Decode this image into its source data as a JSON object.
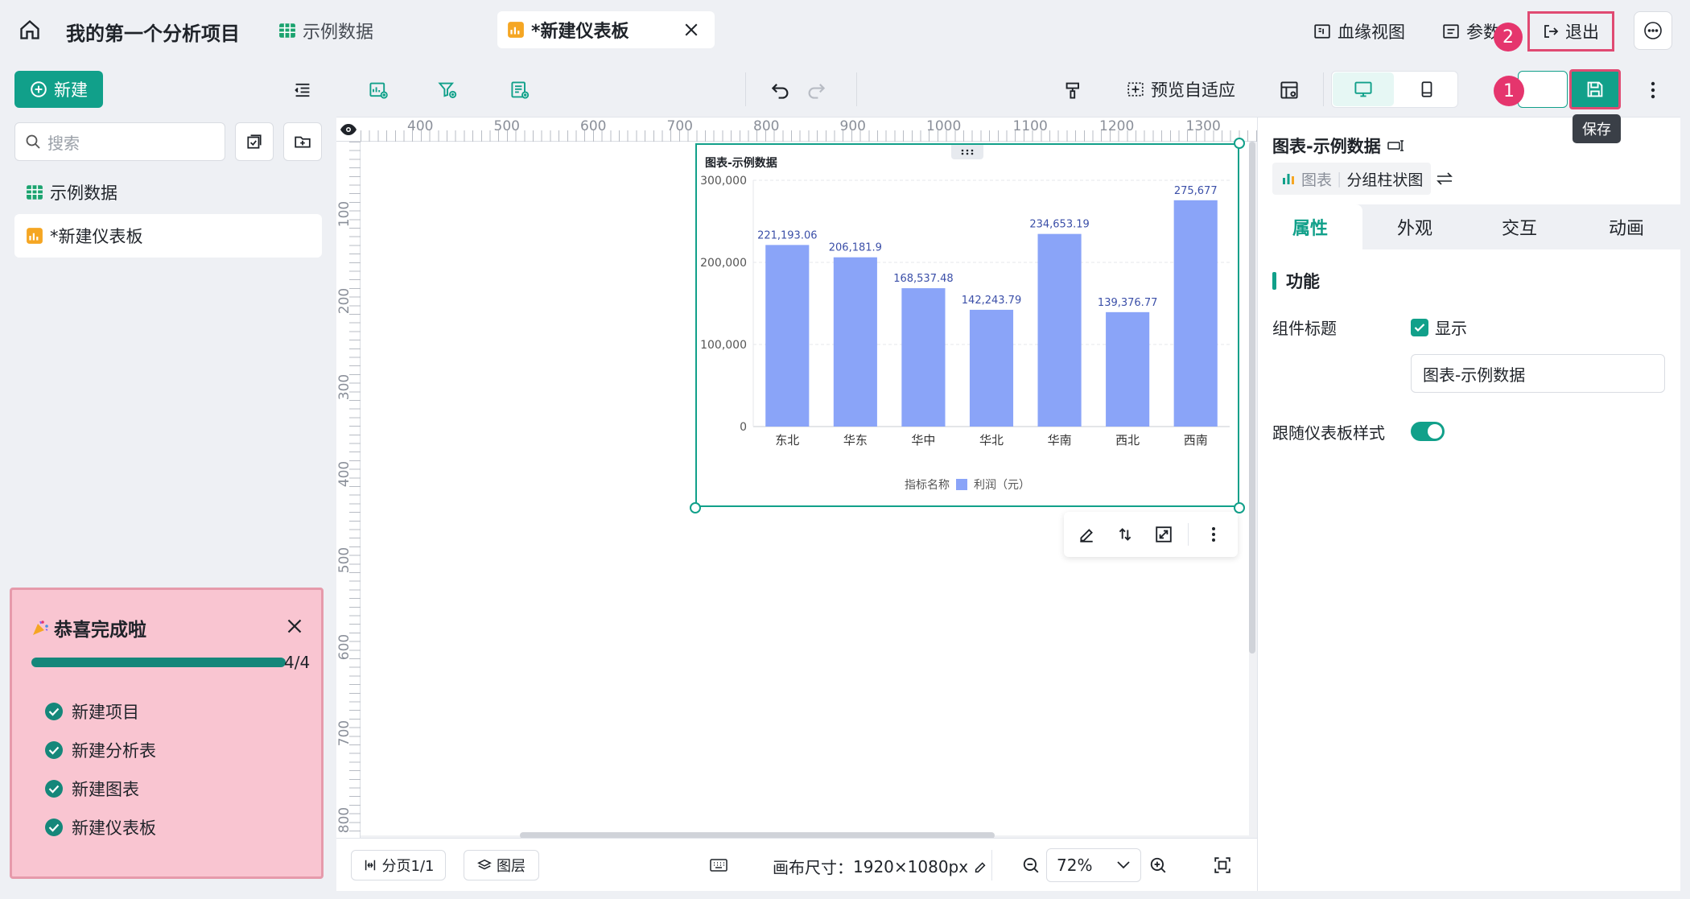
{
  "topbar": {
    "project_title": "我的第一个分析项目",
    "tabs": [
      {
        "label": "示例数据"
      },
      {
        "label": "*新建仪表板"
      }
    ],
    "lineage_label": "血缘视图",
    "params_label": "参数",
    "exit_label": "退出",
    "badge_1": "1",
    "badge_2": "2"
  },
  "sidebar": {
    "new_label": "新建",
    "search_placeholder": "搜索",
    "items": [
      {
        "label": "示例数据"
      },
      {
        "label": "*新建仪表板"
      }
    ]
  },
  "toolbar": {
    "preview_fit_label": "预览自适应",
    "save_tooltip": "保存"
  },
  "ruler": {
    "top": [
      "400",
      "500",
      "600",
      "700",
      "800",
      "900",
      "1000",
      "1100",
      "1200",
      "1300"
    ],
    "left": [
      "100",
      "200",
      "300",
      "400",
      "500",
      "600",
      "700",
      "800"
    ]
  },
  "chart": {
    "title": "图表-示例数据",
    "legend_prefix": "指标名称",
    "legend_series": "利润（元）",
    "color": "#8aa4f8"
  },
  "chart_data": {
    "type": "bar",
    "title": "图表-示例数据",
    "categories": [
      "东北",
      "华东",
      "华中",
      "华北",
      "华南",
      "西北",
      "西南"
    ],
    "series": [
      {
        "name": "利润（元）",
        "values": [
          221193.06,
          206181.9,
          168537.48,
          142243.79,
          234653.19,
          139376.77,
          275677
        ]
      }
    ],
    "value_labels": [
      "221,193.06",
      "206,181.9",
      "168,537.48",
      "142,243.79",
      "234,653.19",
      "139,376.77",
      "275,677"
    ],
    "y_ticks": [
      "0",
      "100,000",
      "200,000",
      "300,000"
    ],
    "ylim": [
      0,
      300000
    ],
    "grid": true,
    "legend": "bottom"
  },
  "bottombar": {
    "page_label": "分页1/1",
    "layer_label": "图层",
    "canvas_size_label": "画布尺寸：",
    "canvas_size_value": "1920×1080px",
    "zoom_value": "72%"
  },
  "rightpanel": {
    "header_title": "图表-示例数据",
    "chart_type_prefix": "图表",
    "chart_type_name": "分组柱状图",
    "tabs": [
      {
        "label": "属性"
      },
      {
        "label": "外观"
      },
      {
        "label": "交互"
      },
      {
        "label": "动画"
      }
    ],
    "section_title": "功能",
    "component_title_label": "组件标题",
    "show_label": "显示",
    "title_input_value": "图表-示例数据",
    "follow_style_label": "跟随仪表板样式"
  },
  "celebrate": {
    "title": "恭喜完成啦",
    "progress_text": "4/4",
    "progress": 1.0,
    "steps": [
      {
        "label": "新建项目"
      },
      {
        "label": "新建分析表"
      },
      {
        "label": "新建图表"
      },
      {
        "label": "新建仪表板"
      }
    ]
  }
}
